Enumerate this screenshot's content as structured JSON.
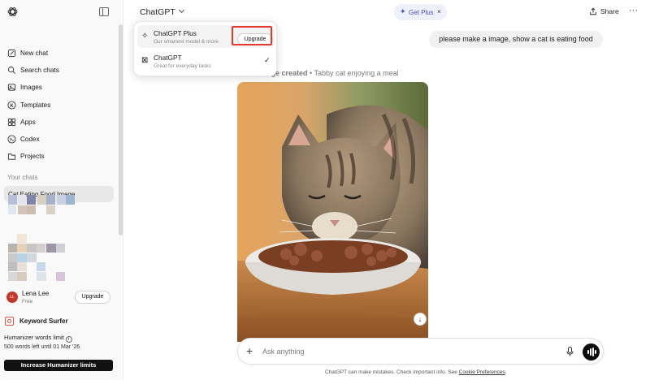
{
  "sidebar": {
    "items": [
      {
        "label": "New chat",
        "icon": "new-chat-icon"
      },
      {
        "label": "Search chats",
        "icon": "search-icon"
      },
      {
        "label": "Images",
        "icon": "images-icon"
      },
      {
        "label": "Templates",
        "icon": "templates-icon"
      },
      {
        "label": "Apps",
        "icon": "apps-icon"
      },
      {
        "label": "Codex",
        "icon": "codex-icon"
      },
      {
        "label": "Projects",
        "icon": "folder-icon"
      }
    ],
    "section_label": "Your chats",
    "selected_chat": "Cat Eating Food Image",
    "user": {
      "initials": "LL",
      "name": "Lena Lee",
      "plan": "Free",
      "upgrade_label": "Upgrade"
    },
    "keyword_surfer": "Keyword Surfer",
    "humanizer": {
      "title": "Humanizer words limit",
      "info": "i",
      "subtitle": "500 words left until 01 Mar '26",
      "button": "Increase Humanizer limits"
    }
  },
  "header": {
    "model_selector": "ChatGPT",
    "get_plus": {
      "star": "✦",
      "label": "Get Plus",
      "close": "×"
    },
    "share_label": "Share",
    "more": "···"
  },
  "dropdown": {
    "options": [
      {
        "title": "ChatGPT Plus",
        "desc": "Our smartest model & more",
        "button": "Upgrade",
        "icon": "sparkles-icon",
        "glyph": "✧"
      },
      {
        "title": "ChatGPT",
        "desc": "Great for everyday tasks",
        "icon": "chatgpt-icon",
        "glyph": "⊠",
        "check": "✓"
      }
    ]
  },
  "chat": {
    "user_message": "please make a image, show a cat is eating food",
    "image_label_prefix": "Image created",
    "image_label_caption": "• Tabby cat enjoying a meal",
    "image_alt": "Tabby cat eating wet food from a white bowl",
    "scroll_down": "↓"
  },
  "composer": {
    "plus": "+",
    "placeholder": "Ask anything"
  },
  "footer": {
    "text": "ChatGPT can make mistakes. Check important info. See ",
    "link": "Cookie Preferences",
    "end": "."
  },
  "colors": {
    "accent_red": "#e03a2e",
    "get_plus_text": "#4a4fc7",
    "avatar": "#c0392b",
    "keyword_surfer": "#e0543d"
  }
}
